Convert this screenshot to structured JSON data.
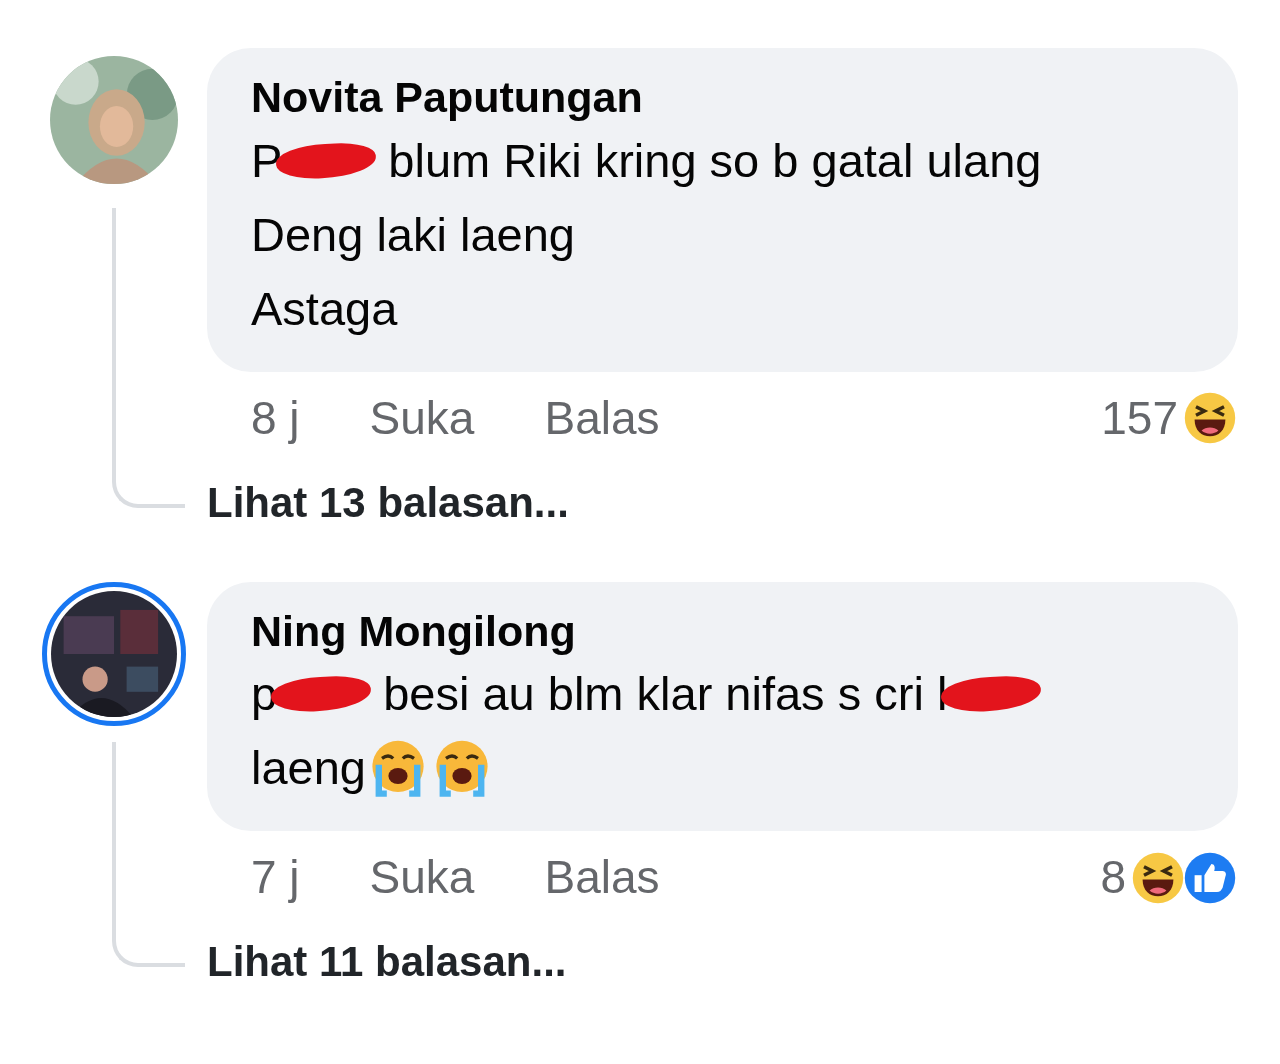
{
  "comments": [
    {
      "author": "Novita Paputungan",
      "story_ring": false,
      "lines": [
        [
          {
            "kind": "text",
            "text": "P"
          },
          {
            "kind": "redaction"
          },
          {
            "kind": "text",
            "text": "blum Riki kring so b gatal ulang"
          }
        ],
        [
          {
            "kind": "text",
            "text": "Deng laki laeng"
          }
        ],
        [
          {
            "kind": "text",
            "text": "Astaga"
          }
        ]
      ],
      "time": "8 j",
      "like": "Suka",
      "reply": "Balas",
      "reaction_count": "157",
      "reactions": [
        {
          "kind": "haha"
        }
      ],
      "replies_link": "Lihat 13 balasan..."
    },
    {
      "author": "Ning Mongilong",
      "story_ring": true,
      "lines": [
        [
          {
            "kind": "text",
            "text": "p"
          },
          {
            "kind": "redaction"
          },
          {
            "kind": "text",
            "text": "besi au blm klar nifas s cri l"
          },
          {
            "kind": "redaction"
          }
        ],
        [
          {
            "kind": "text",
            "text": "laeng"
          },
          {
            "kind": "crying-emoji"
          },
          {
            "kind": "crying-emoji"
          }
        ]
      ],
      "time": "7 j",
      "like": "Suka",
      "reply": "Balas",
      "reaction_count": "8",
      "reactions": [
        {
          "kind": "haha"
        },
        {
          "kind": "like"
        }
      ],
      "replies_link": "Lihat 11 balasan..."
    }
  ]
}
